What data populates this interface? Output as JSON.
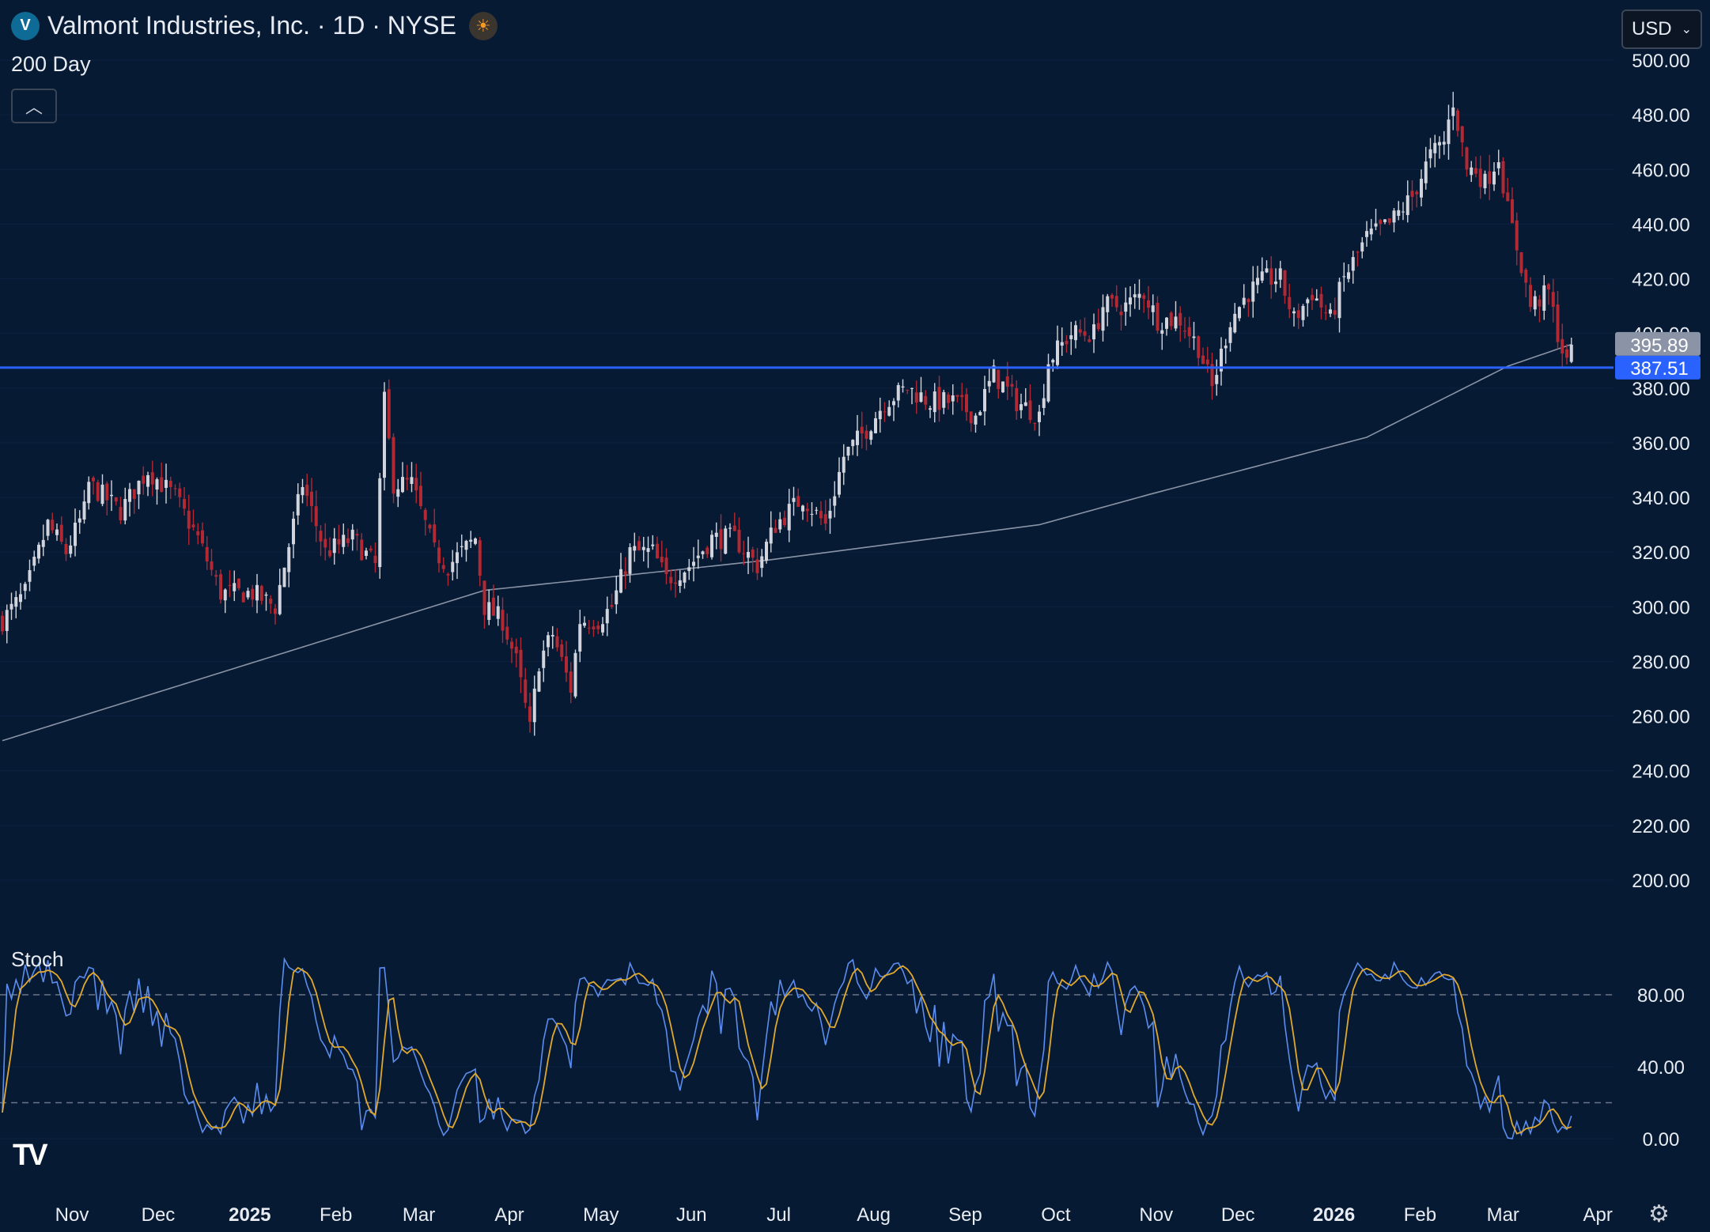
{
  "header": {
    "title": "Valmont Industries, Inc. · 1D · NYSE",
    "logo_icon": "valmont-logo-icon",
    "session_icon": "pre-market-sun-icon",
    "ma_label": "200 Day",
    "collapse_icon": "chevron-up-icon"
  },
  "currency": {
    "selected": "USD"
  },
  "stoch_label": "Stoch",
  "brand": "TV",
  "colors": {
    "background": "#061a33",
    "up": "#d1d4dc",
    "down": "#b22833",
    "hline": "#2962ff",
    "ma": "#8a94a6",
    "stoch_k": "#5b8def",
    "stoch_d": "#e0a82e"
  },
  "chart_data": {
    "type": "candlestick",
    "title": "Valmont Industries, Inc. · 1D · NYSE",
    "x_unit": "trading-session index",
    "price_axis": {
      "min": 200,
      "max": 500,
      "ticks": [
        "500.00",
        "480.00",
        "460.00",
        "440.00",
        "420.00",
        "400.00",
        "380.00",
        "360.00",
        "340.00",
        "320.00",
        "300.00",
        "280.00",
        "260.00",
        "240.00",
        "220.00",
        "200.00"
      ]
    },
    "last_price": "395.89",
    "horizontal_line": {
      "value": 387.51,
      "label": "387.51"
    },
    "time_axis": [
      "Nov",
      "Dec",
      "2025",
      "Feb",
      "Mar",
      "Apr",
      "May",
      "Jun",
      "Jul",
      "Aug",
      "Sep",
      "Oct",
      "Nov",
      "Dec",
      "2026",
      "Feb",
      "Mar",
      "Apr"
    ],
    "time_axis_bold": [
      "2025",
      "2026"
    ],
    "close_keypoints": [
      [
        0,
        295
      ],
      [
        5,
        305
      ],
      [
        10,
        330
      ],
      [
        14,
        320
      ],
      [
        18,
        335
      ],
      [
        19,
        345
      ],
      [
        26,
        335
      ],
      [
        32,
        350
      ],
      [
        38,
        340
      ],
      [
        43,
        325
      ],
      [
        48,
        305
      ],
      [
        55,
        305
      ],
      [
        60,
        300
      ],
      [
        64,
        330
      ],
      [
        66,
        345
      ],
      [
        71,
        320
      ],
      [
        77,
        325
      ],
      [
        82,
        315
      ],
      [
        84,
        375
      ],
      [
        86,
        345
      ],
      [
        90,
        345
      ],
      [
        95,
        320
      ],
      [
        98,
        315
      ],
      [
        104,
        325
      ],
      [
        106,
        300
      ],
      [
        110,
        295
      ],
      [
        113,
        280
      ],
      [
        116,
        255
      ],
      [
        118,
        280
      ],
      [
        121,
        290
      ],
      [
        125,
        270
      ],
      [
        127,
        295
      ],
      [
        131,
        295
      ],
      [
        134,
        300
      ],
      [
        138,
        320
      ],
      [
        143,
        320
      ],
      [
        146,
        310
      ],
      [
        151,
        315
      ],
      [
        156,
        325
      ],
      [
        161,
        325
      ],
      [
        166,
        315
      ],
      [
        170,
        330
      ],
      [
        176,
        340
      ],
      [
        181,
        330
      ],
      [
        185,
        355
      ],
      [
        190,
        365
      ],
      [
        194,
        375
      ],
      [
        199,
        380
      ],
      [
        204,
        375
      ],
      [
        209,
        375
      ],
      [
        214,
        370
      ],
      [
        218,
        385
      ],
      [
        223,
        375
      ],
      [
        228,
        370
      ],
      [
        230,
        390
      ],
      [
        235,
        400
      ],
      [
        240,
        400
      ],
      [
        242,
        410
      ],
      [
        247,
        410
      ],
      [
        251,
        415
      ],
      [
        254,
        405
      ],
      [
        259,
        405
      ],
      [
        263,
        395
      ],
      [
        266,
        380
      ],
      [
        270,
        405
      ],
      [
        274,
        415
      ],
      [
        278,
        420
      ],
      [
        281,
        420
      ],
      [
        284,
        405
      ],
      [
        288,
        415
      ],
      [
        292,
        405
      ],
      [
        295,
        420
      ],
      [
        300,
        435
      ],
      [
        305,
        440
      ],
      [
        310,
        450
      ],
      [
        314,
        465
      ],
      [
        317,
        470
      ],
      [
        319,
        485
      ],
      [
        322,
        460
      ],
      [
        324,
        460
      ],
      [
        326,
        455
      ],
      [
        329,
        465
      ],
      [
        331,
        445
      ],
      [
        334,
        425
      ],
      [
        336,
        410
      ],
      [
        340,
        415
      ],
      [
        342,
        400
      ],
      [
        344,
        388
      ],
      [
        345,
        395.89
      ]
    ],
    "ma200_keypoints": [
      [
        0,
        251
      ],
      [
        106,
        306
      ],
      [
        168,
        317
      ],
      [
        228,
        330
      ],
      [
        252,
        341
      ],
      [
        300,
        362
      ],
      [
        331,
        388
      ],
      [
        345,
        396
      ]
    ],
    "stoch_axis": {
      "ticks": [
        "80.00",
        "40.00",
        "0.00"
      ],
      "bands": [
        80,
        20
      ]
    }
  }
}
